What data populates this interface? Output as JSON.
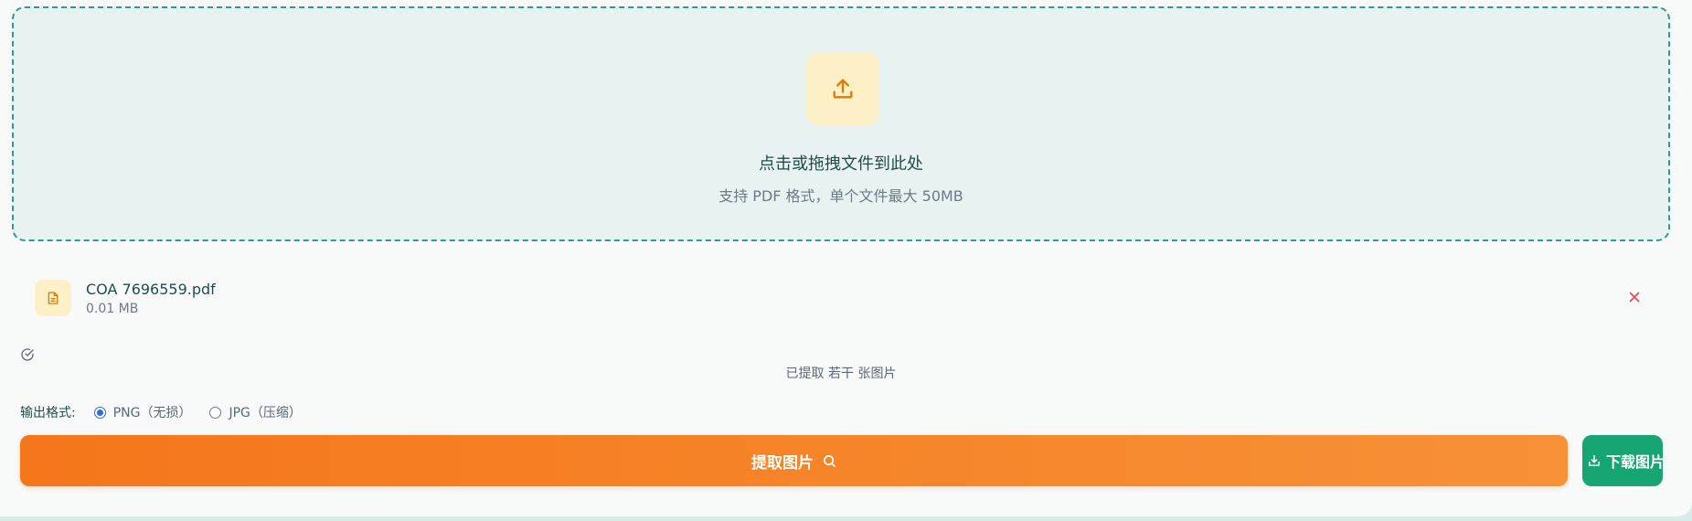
{
  "dropzone": {
    "icon": "upload-icon",
    "title": "点击或拖拽文件到此处",
    "subtitle": "支持 PDF 格式，单个文件最大 50MB"
  },
  "file": {
    "icon": "file-icon",
    "name": "COA 7696559.pdf",
    "size": "0.01 MB",
    "remove_icon": "close-icon"
  },
  "status": {
    "icon": "check-circle-icon",
    "text": "已提取 若干 张图片"
  },
  "format": {
    "label": "输出格式:",
    "options": [
      {
        "label": "PNG（无损）",
        "selected": true
      },
      {
        "label": "JPG（压缩）",
        "selected": false
      }
    ]
  },
  "actions": {
    "extract_label": "提取图片",
    "extract_icon": "search-icon",
    "download_label": "下载图片",
    "download_icon": "download-icon"
  },
  "colors": {
    "accent_orange": "#f5761b",
    "accent_green": "#17a673",
    "border_teal": "#2a9d8f"
  }
}
